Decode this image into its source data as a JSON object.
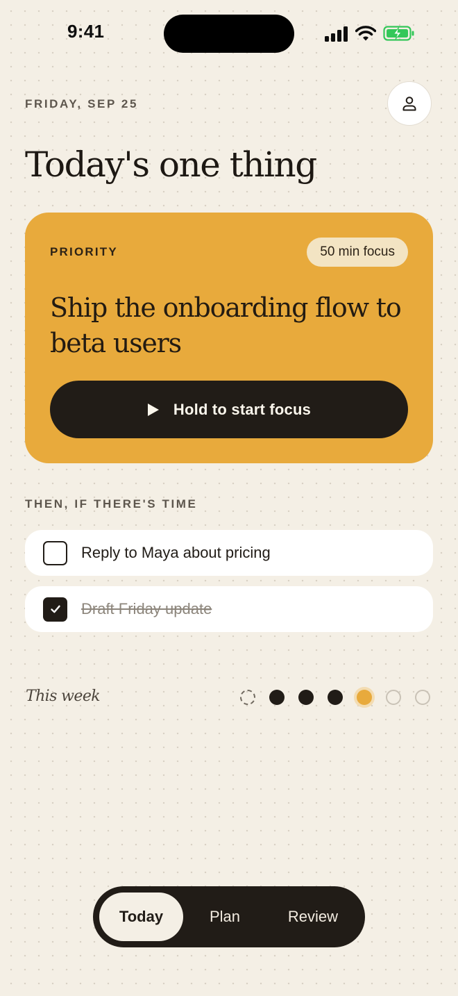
{
  "status_bar": {
    "time": "9:41",
    "battery_state": "charging"
  },
  "header": {
    "date": "FRIDAY, SEP 25",
    "title": "Today's one thing",
    "profile_icon": "person-icon"
  },
  "priority": {
    "label": "PRIORITY",
    "duration": "50 min focus",
    "task": "Ship the onboarding flow to beta users",
    "action_label": "Hold to start focus",
    "accent_color": "#e8aa3c"
  },
  "secondary": {
    "label": "THEN, IF THERE'S TIME",
    "tasks": [
      {
        "text": "Reply to Maya about pricing",
        "done": false
      },
      {
        "text": "Draft Friday update",
        "done": true
      }
    ]
  },
  "week": {
    "label": "This week",
    "days": [
      "pending",
      "done",
      "done",
      "done",
      "today",
      "future",
      "future"
    ]
  },
  "tabs": {
    "today": "Today",
    "plan": "Plan",
    "review": "Review",
    "active": "Today"
  }
}
